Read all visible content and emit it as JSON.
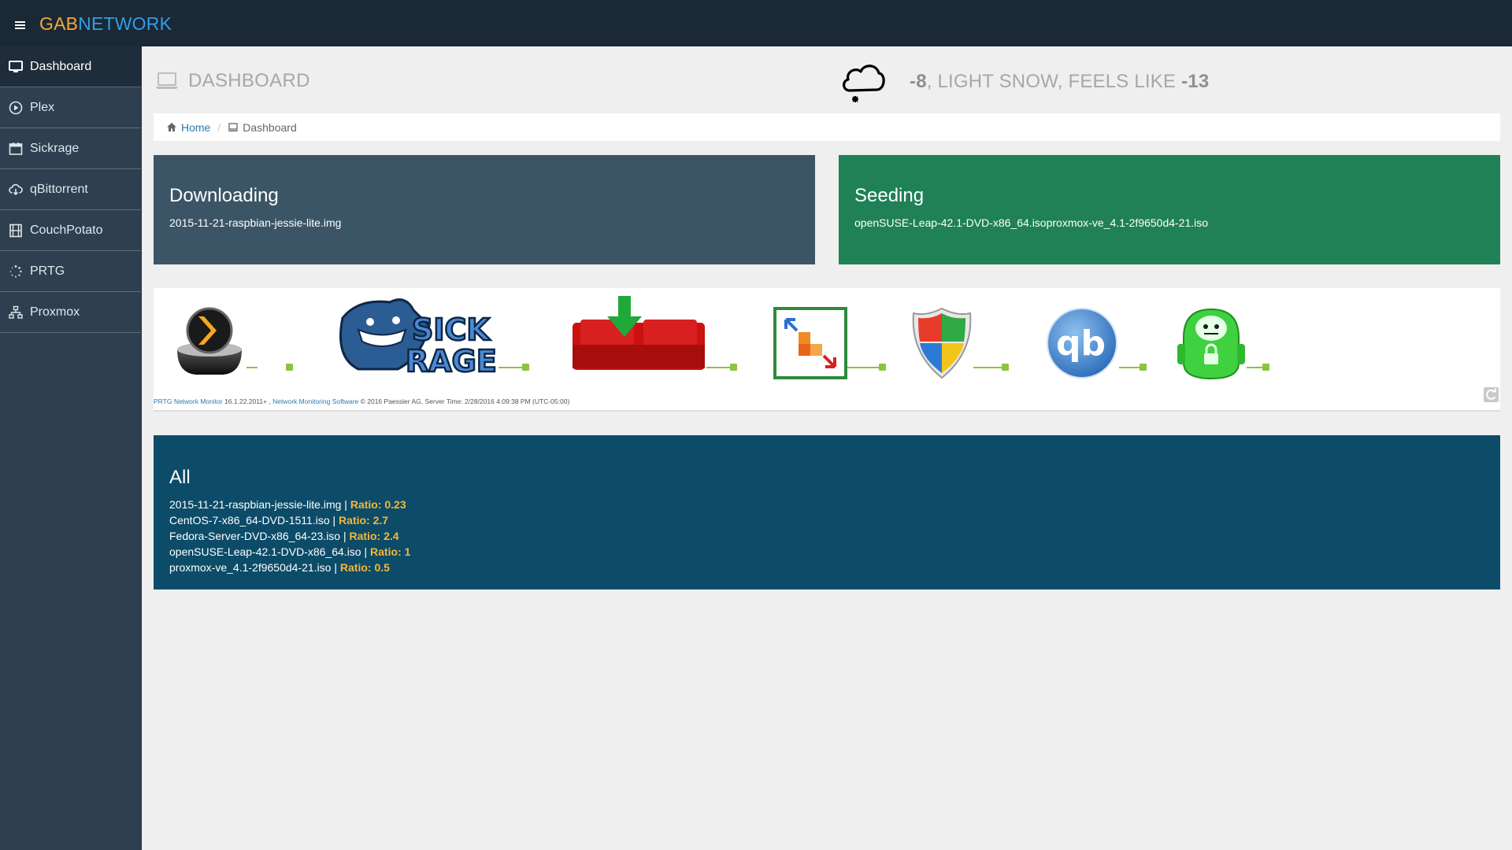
{
  "brand": {
    "part1": "GAB",
    "part2": "NETWORK"
  },
  "sidebar": {
    "items": [
      {
        "label": "Dashboard",
        "icon": "monitor-icon"
      },
      {
        "label": "Plex",
        "icon": "play-circle-icon"
      },
      {
        "label": "Sickrage",
        "icon": "calendar-icon"
      },
      {
        "label": "qBittorrent",
        "icon": "cloud-download-icon"
      },
      {
        "label": "CouchPotato",
        "icon": "film-icon"
      },
      {
        "label": "PRTG",
        "icon": "spinner-icon"
      },
      {
        "label": "Proxmox",
        "icon": "sitemap-icon"
      }
    ]
  },
  "header": {
    "title": "DASHBOARD"
  },
  "weather": {
    "temp": "-8",
    "conditions": ", LIGHT SNOW, FEELS LIKE ",
    "feels_like": "-13",
    "icon": "snow-cloud-icon"
  },
  "breadcrumb": {
    "home": "Home",
    "current": "Dashboard"
  },
  "downloading": {
    "title": "Downloading",
    "items": [
      "2015-11-21-raspbian-jessie-lite.img"
    ]
  },
  "seeding": {
    "title": "Seeding",
    "items": [
      "openSUSE-Leap-42.1-DVD-x86_64.isoproxmox-ve_4.1-2f9650d4-21.iso"
    ]
  },
  "prtg": {
    "footer_link1": "PRTG Network Monitor",
    "footer_version": " 16.1.22.2011+ , ",
    "footer_link2": "Network Monitoring Software",
    "footer_rest": " © 2016 Paessler AG, Server Time: 2/28/2016 4:09:38 PM (UTC-05:00)",
    "sensors": [
      "plex-logo",
      "sickrage-logo",
      "couchpotato-logo",
      "proxmox-logo",
      "windows-shield-logo",
      "qbittorrent-logo",
      "vpn-lock-logo"
    ],
    "logo_text": {
      "sickrage": "SICK RAGE",
      "qbittorrent": "qb"
    }
  },
  "all": {
    "title": "All",
    "items": [
      {
        "name": "2015-11-21-raspbian-jessie-lite.img",
        "ratio": "Ratio: 0.23"
      },
      {
        "name": "CentOS-7-x86_64-DVD-1511.iso",
        "ratio": "Ratio: 2.7"
      },
      {
        "name": "Fedora-Server-DVD-x86_64-23.iso",
        "ratio": "Ratio: 2.4"
      },
      {
        "name": "openSUSE-Leap-42.1-DVD-x86_64.iso",
        "ratio": "Ratio: 1"
      },
      {
        "name": "proxmox-ve_4.1-2f9650d4-21.iso",
        "ratio": "Ratio: 0.5"
      }
    ],
    "separator": " | "
  },
  "colors": {
    "topbar": "#1b2836",
    "sidebar": "#2f3f4f",
    "downloading": "#3c5566",
    "seeding": "#1f8155",
    "all": "#0c4c68",
    "ratio": "#f4b73d",
    "brand_orange": "#f4a93b",
    "brand_blue": "#2f9fe5"
  }
}
